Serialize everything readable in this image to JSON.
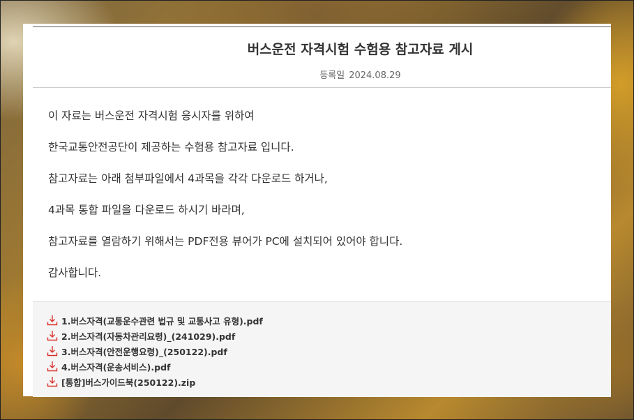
{
  "post": {
    "title": "버스운전 자격시험 수험용 참고자료 게시",
    "date_label": "등록일",
    "date_value": "2024.08.29"
  },
  "body": {
    "paragraphs": [
      "이 자료는 버스운전 자격시험 응시자를 위하여",
      "한국교통안전공단이 제공하는 수험용 참고자료 입니다.",
      "참고자료는 아래 첨부파일에서 4과목을 각각 다운로드 하거나,",
      "4과목 통합 파일을 다운로드 하시기 바라며,",
      "참고자료를 열람하기 위해서는 PDF전용 뷰어가 PC에 설치되어 있어야 합니다.",
      "감사합니다."
    ]
  },
  "attachments": {
    "icon": "download-icon",
    "icon_color": "#d9312b",
    "files": [
      "1.버스자격(교통운수관련 법규 및 교통사고 유형).pdf",
      "2.버스자격(자동차관리요령)_(241029).pdf",
      "3.버스자격(안전운행요령)_(250122).pdf",
      "4.버스자격(운송서비스).pdf",
      "[통합]버스가이드북(250122).zip"
    ]
  }
}
